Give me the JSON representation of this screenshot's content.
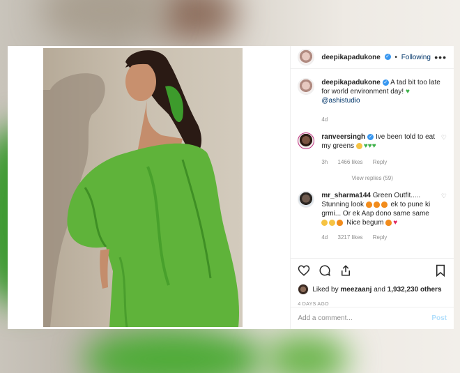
{
  "header": {
    "username": "deepikapadukone",
    "follow_state": "Following",
    "more": "•••"
  },
  "caption": {
    "username": "deepikapadukone",
    "text": "A tad bit too late for world environment day!",
    "mention": "@ashistudio",
    "time": "4d"
  },
  "comments": [
    {
      "username": "ranveersingh",
      "text": "Ive been told to eat my greens",
      "time": "3h",
      "likes": "1466 likes",
      "reply": "Reply"
    },
    {
      "username": "mr_sharma144",
      "text": "Green Outfit..... Stunning look",
      "text2": "ek to pune ki grmi... Or ek Aap dono same same",
      "text3": "Nice begum",
      "time": "4d",
      "likes": "3217 likes",
      "reply": "Reply"
    }
  ],
  "view_replies": "View replies (59)",
  "liked_by": {
    "prefix": "Liked by",
    "user": "meezaanj",
    "and": "and",
    "others": "1,932,230 others"
  },
  "date": "4 DAYS AGO",
  "add_comment": {
    "placeholder": "Add a comment...",
    "post": "Post"
  },
  "colors": {
    "verified": "#3897f0",
    "dress": "#5fb33a",
    "post_button": "#b2dffc"
  }
}
